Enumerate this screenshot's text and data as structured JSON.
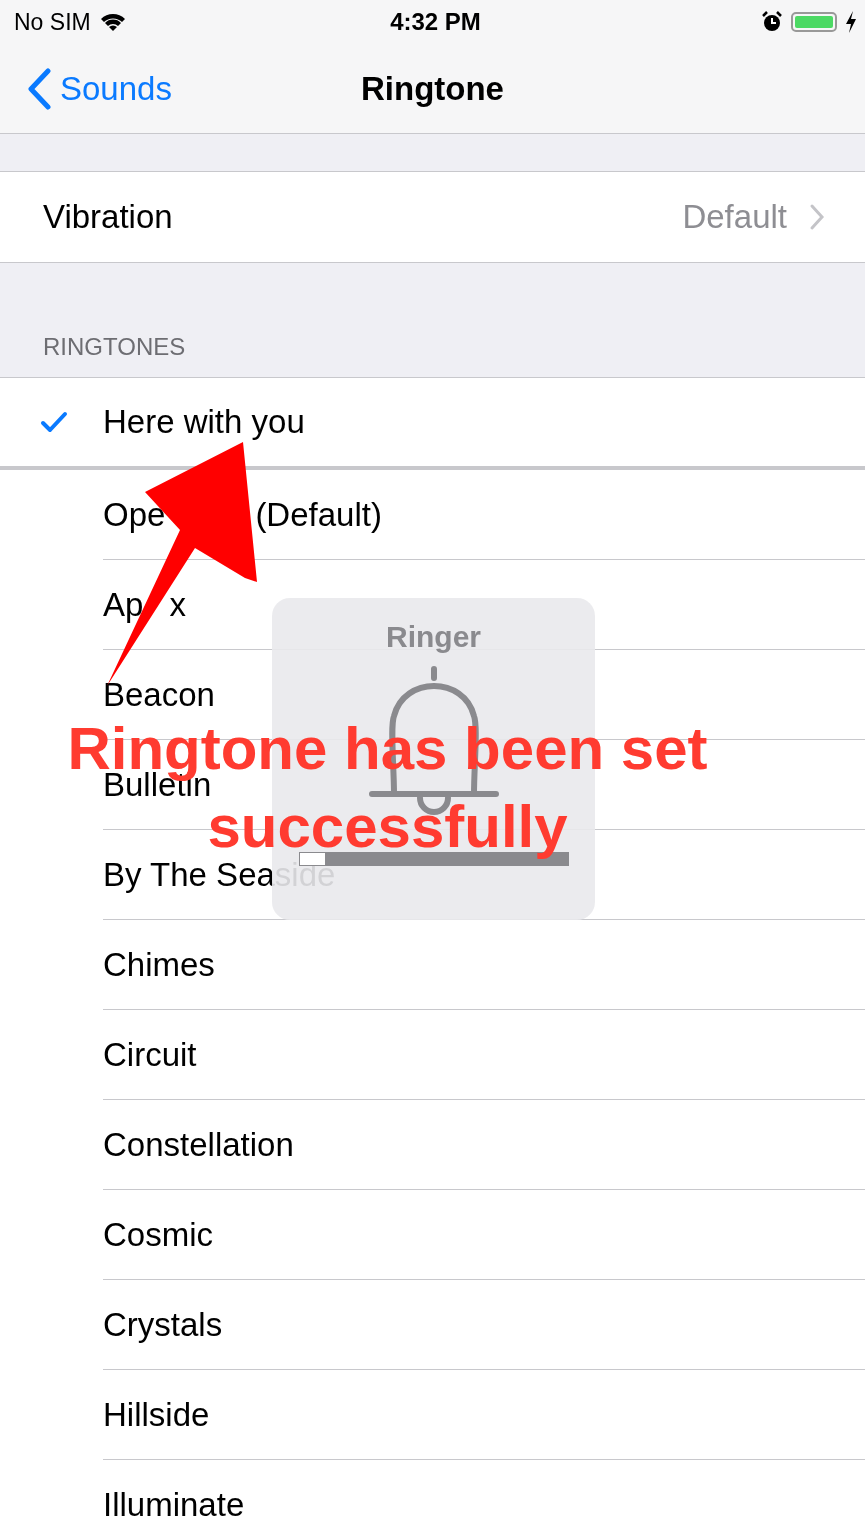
{
  "status_bar": {
    "carrier": "No SIM",
    "time": "4:32 PM",
    "charging": true,
    "alarm": true
  },
  "nav": {
    "back": "Sounds",
    "title": "Ringtone"
  },
  "vibration": {
    "label": "Vibration",
    "value": "Default"
  },
  "ringtones": {
    "header": "RINGTONES",
    "items": [
      {
        "name": "Here with you",
        "selected": true
      },
      {
        "name": "Ope",
        "tail": "(Default)",
        "selected": false
      },
      {
        "name": "Ap",
        "tail": "x",
        "selected": false
      },
      {
        "name": "Beacon",
        "selected": false
      },
      {
        "name": "Bulletin",
        "selected": false
      },
      {
        "name": "By The Seaside",
        "selected": false
      },
      {
        "name": "Chimes",
        "selected": false
      },
      {
        "name": "Circuit",
        "selected": false
      },
      {
        "name": "Constellation",
        "selected": false
      },
      {
        "name": "Cosmic",
        "selected": false
      },
      {
        "name": "Crystals",
        "selected": false
      },
      {
        "name": "Hillside",
        "selected": false
      },
      {
        "name": "Illuminate",
        "selected": false
      }
    ]
  },
  "ringer_hud": {
    "title": "Ringer",
    "level": 0.1
  },
  "annotation": {
    "lines": [
      "Ringtone has been set",
      "successfully"
    ]
  }
}
